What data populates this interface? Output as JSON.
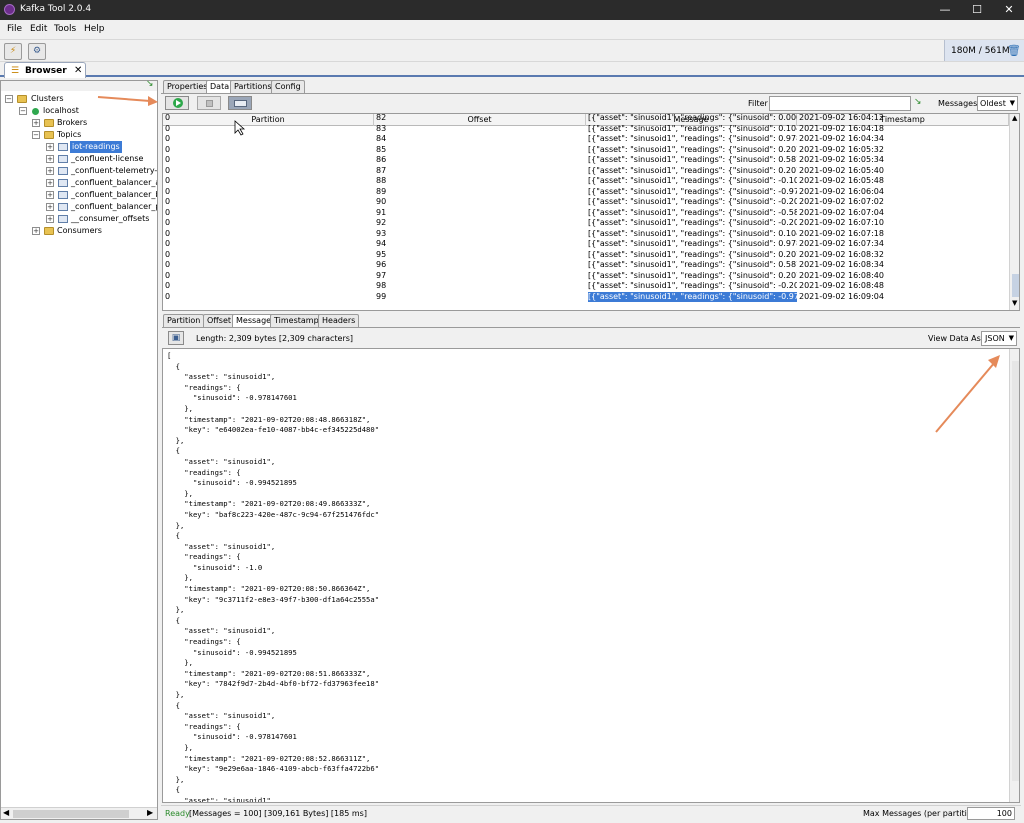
{
  "window": {
    "title": "Kafka Tool  2.0.4",
    "min": "—",
    "max": "☐",
    "close": "✕"
  },
  "menu": {
    "file": "File",
    "edit": "Edit",
    "tools": "Tools",
    "help": "Help"
  },
  "memory": {
    "text": "180M / 561M"
  },
  "doc_tab": {
    "label": "Browser",
    "close": "✕"
  },
  "tree": {
    "clusters": "Clusters",
    "localhost": "localhost",
    "brokers": "Brokers",
    "topics": "Topics",
    "topic_items": [
      "iot-readings",
      "_confluent-license",
      "_confluent-telemetry-me",
      "_confluent_balancer_api_",
      "_confluent_balancer_brok",
      "_confluent_balancer_part",
      "__consumer_offsets"
    ],
    "consumers": "Consumers"
  },
  "tabs": [
    "Properties",
    "Data",
    "Partitions",
    "Config"
  ],
  "data_toolbar": {
    "filter_label": "Filter",
    "filter_value": "",
    "messages_label": "Messages",
    "order_value": "Oldest"
  },
  "table": {
    "headers": [
      "Partition",
      "Offset",
      "Message",
      "Timestamp"
    ],
    "rows": [
      {
        "partition": "0",
        "offset": "82",
        "message": "[{\"asset\": \"sinusoid1\", \"readings\": {\"sinusoid\": 0.000000...",
        "timestamp": "2021-09-02 16:04:12"
      },
      {
        "partition": "0",
        "offset": "83",
        "message": "[{\"asset\": \"sinusoid1\", \"readings\": {\"sinusoid\": 0.1045284...",
        "timestamp": "2021-09-02 16:04:18"
      },
      {
        "partition": "0",
        "offset": "84",
        "message": "[{\"asset\": \"sinusoid1\", \"readings\": {\"sinusoid\": 0.9781476...",
        "timestamp": "2021-09-02 16:04:34"
      },
      {
        "partition": "0",
        "offset": "85",
        "message": "[{\"asset\": \"sinusoid1\", \"readings\": {\"sinusoid\": 0.2079116...",
        "timestamp": "2021-09-02 16:05:32"
      },
      {
        "partition": "0",
        "offset": "86",
        "message": "[{\"asset\": \"sinusoid1\", \"readings\": {\"sinusoid\": 0.5877852...",
        "timestamp": "2021-09-02 16:05:34"
      },
      {
        "partition": "0",
        "offset": "87",
        "message": "[{\"asset\": \"sinusoid1\", \"readings\": {\"sinusoid\": 0.2079116...",
        "timestamp": "2021-09-02 16:05:40"
      },
      {
        "partition": "0",
        "offset": "88",
        "message": "[{\"asset\": \"sinusoid1\", \"readings\": {\"sinusoid\": -0.104528...",
        "timestamp": "2021-09-02 16:05:48"
      },
      {
        "partition": "0",
        "offset": "89",
        "message": "[{\"asset\": \"sinusoid1\", \"readings\": {\"sinusoid\": -0.978147...",
        "timestamp": "2021-09-02 16:06:04"
      },
      {
        "partition": "0",
        "offset": "90",
        "message": "[{\"asset\": \"sinusoid1\", \"readings\": {\"sinusoid\": -0.207911...",
        "timestamp": "2021-09-02 16:07:02"
      },
      {
        "partition": "0",
        "offset": "91",
        "message": "[{\"asset\": \"sinusoid1\", \"readings\": {\"sinusoid\": -0.587785...",
        "timestamp": "2021-09-02 16:07:04"
      },
      {
        "partition": "0",
        "offset": "92",
        "message": "[{\"asset\": \"sinusoid1\", \"readings\": {\"sinusoid\": -0.207911...",
        "timestamp": "2021-09-02 16:07:10"
      },
      {
        "partition": "0",
        "offset": "93",
        "message": "[{\"asset\": \"sinusoid1\", \"readings\": {\"sinusoid\": 0.1045284...",
        "timestamp": "2021-09-02 16:07:18"
      },
      {
        "partition": "0",
        "offset": "94",
        "message": "[{\"asset\": \"sinusoid1\", \"readings\": {\"sinusoid\": 0.9781476...",
        "timestamp": "2021-09-02 16:07:34"
      },
      {
        "partition": "0",
        "offset": "95",
        "message": "[{\"asset\": \"sinusoid1\", \"readings\": {\"sinusoid\": 0.2079116...",
        "timestamp": "2021-09-02 16:08:32"
      },
      {
        "partition": "0",
        "offset": "96",
        "message": "[{\"asset\": \"sinusoid1\", \"readings\": {\"sinusoid\": 0.5877852...",
        "timestamp": "2021-09-02 16:08:34"
      },
      {
        "partition": "0",
        "offset": "97",
        "message": "[{\"asset\": \"sinusoid1\", \"readings\": {\"sinusoid\": 0.2079116...",
        "timestamp": "2021-09-02 16:08:40"
      },
      {
        "partition": "0",
        "offset": "98",
        "message": "[{\"asset\": \"sinusoid1\", \"readings\": {\"sinusoid\": -0.207911...",
        "timestamp": "2021-09-02 16:08:48"
      },
      {
        "partition": "0",
        "offset": "99",
        "message": "[{\"asset\": \"sinusoid1\", \"readings\": {\"sinusoid\": -0.978147...",
        "timestamp": "2021-09-02 16:09:04",
        "selected": true
      }
    ]
  },
  "subtabs": [
    "Partition",
    "Offset",
    "Message",
    "Timestamp",
    "Headers"
  ],
  "detail": {
    "length": "Length: 2,309 bytes [2,309 characters]",
    "view_as_label": "View Data As",
    "view_as_value": "JSON"
  },
  "json_body": "[\n  {\n    \"asset\": \"sinusoid1\",\n    \"readings\": {\n      \"sinusoid\": -0.978147601\n    },\n    \"timestamp\": \"2021-09-02T20:08:48.866318Z\",\n    \"key\": \"e64002ea-fe10-4087-bb4c-ef345225d480\"\n  },\n  {\n    \"asset\": \"sinusoid1\",\n    \"readings\": {\n      \"sinusoid\": -0.994521895\n    },\n    \"timestamp\": \"2021-09-02T20:08:49.866333Z\",\n    \"key\": \"baf8c223-420e-487c-9c94-67f251476fdc\"\n  },\n  {\n    \"asset\": \"sinusoid1\",\n    \"readings\": {\n      \"sinusoid\": -1.0\n    },\n    \"timestamp\": \"2021-09-02T20:08:50.866364Z\",\n    \"key\": \"9c3711f2-e8e3-49f7-b300-df1a64c2555a\"\n  },\n  {\n    \"asset\": \"sinusoid1\",\n    \"readings\": {\n      \"sinusoid\": -0.994521895\n    },\n    \"timestamp\": \"2021-09-02T20:08:51.866333Z\",\n    \"key\": \"7842f9d7-2b4d-4bf0-bf72-fd37963fee18\"\n  },\n  {\n    \"asset\": \"sinusoid1\",\n    \"readings\": {\n      \"sinusoid\": -0.978147601\n    },\n    \"timestamp\": \"2021-09-02T20:08:52.866311Z\",\n    \"key\": \"9e29e6aa-1846-4109-abcb-f63ffa4722b6\"\n  },\n  {\n    \"asset\": \"sinusoid1\",",
  "status": {
    "ready": "Ready",
    "stats": "[Messages = 100]  [309,161 Bytes]  [185 ms]",
    "max_label": "Max Messages (per partition)",
    "max_value": "100"
  },
  "colors": {
    "accent": "#3c7bd6",
    "annotation_arrow": "#e58a5a",
    "ready": "#2a8a2a"
  }
}
